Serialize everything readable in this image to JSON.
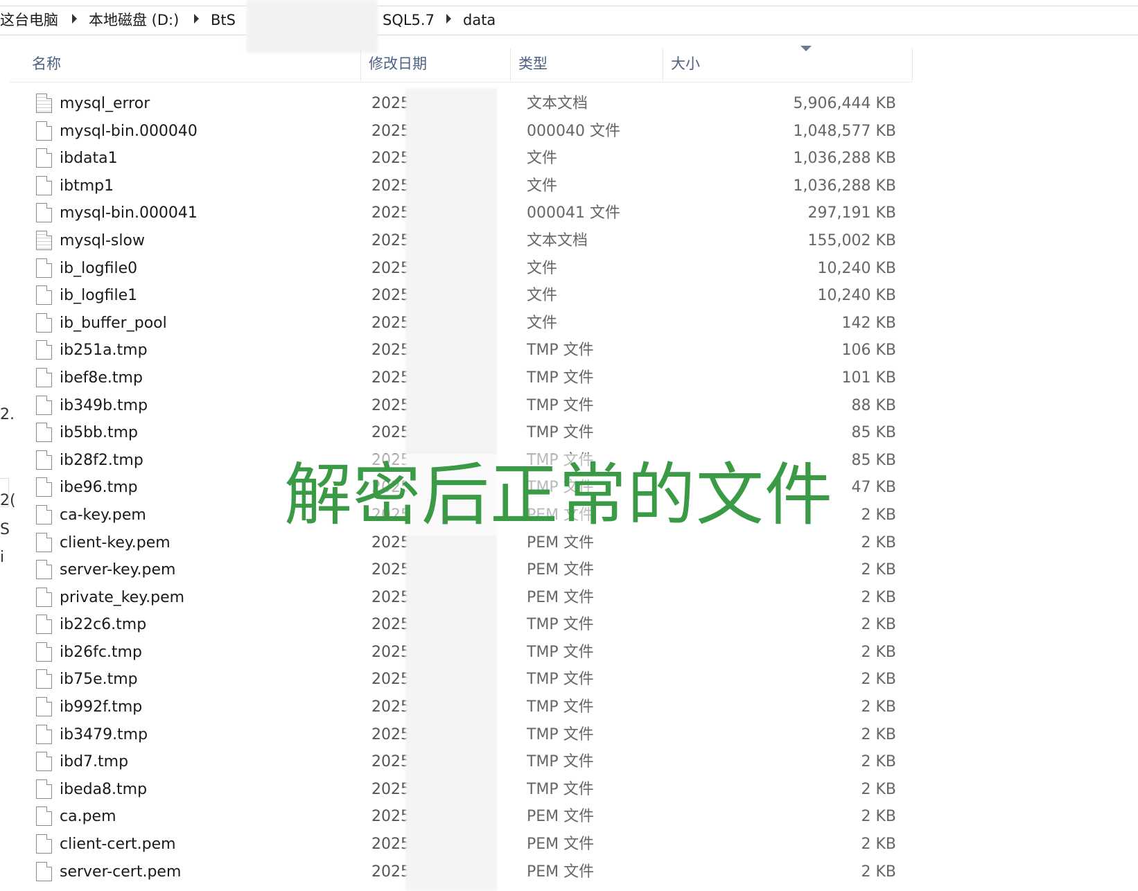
{
  "breadcrumb": {
    "items": [
      "这台电脑",
      "本地磁盘 (D:)",
      "BtS",
      "SQL5.7",
      "data"
    ]
  },
  "columns": {
    "name": "名称",
    "date": "修改日期",
    "type": "类型",
    "size": "大小"
  },
  "files": [
    {
      "name": "mysql_error",
      "date": "2025",
      "type": "文本文档",
      "size": "5,906,444 KB",
      "icon": "text-file-icon"
    },
    {
      "name": "mysql-bin.000040",
      "date": "2025",
      "type": "000040 文件",
      "size": "1,048,577 KB",
      "icon": "file-icon"
    },
    {
      "name": "ibdata1",
      "date": "2025",
      "type": "文件",
      "size": "1,036,288 KB",
      "icon": "file-icon"
    },
    {
      "name": "ibtmp1",
      "date": "2025",
      "type": "文件",
      "size": "1,036,288 KB",
      "icon": "file-icon"
    },
    {
      "name": "mysql-bin.000041",
      "date": "2025",
      "type": "000041 文件",
      "size": "297,191 KB",
      "icon": "file-icon"
    },
    {
      "name": "mysql-slow",
      "date": "2025",
      "type": "文本文档",
      "size": "155,002 KB",
      "icon": "text-file-icon"
    },
    {
      "name": "ib_logfile0",
      "date": "2025",
      "type": "文件",
      "size": "10,240 KB",
      "icon": "file-icon"
    },
    {
      "name": "ib_logfile1",
      "date": "2025",
      "type": "文件",
      "size": "10,240 KB",
      "icon": "file-icon"
    },
    {
      "name": "ib_buffer_pool",
      "date": "2025",
      "type": "文件",
      "size": "142 KB",
      "icon": "file-icon"
    },
    {
      "name": "ib251a.tmp",
      "date": "2025",
      "type": "TMP 文件",
      "size": "106 KB",
      "icon": "file-icon"
    },
    {
      "name": "ibef8e.tmp",
      "date": "2025",
      "type": "TMP 文件",
      "size": "101 KB",
      "icon": "file-icon"
    },
    {
      "name": "ib349b.tmp",
      "date": "2025",
      "type": "TMP 文件",
      "size": "88 KB",
      "icon": "file-icon"
    },
    {
      "name": "ib5bb.tmp",
      "date": "2025",
      "type": "TMP 文件",
      "size": "85 KB",
      "icon": "file-icon"
    },
    {
      "name": "ib28f2.tmp",
      "date": "2025",
      "type": "TMP 文件",
      "size": "85 KB",
      "icon": "file-icon"
    },
    {
      "name": "ibe96.tmp",
      "date": "2025",
      "type": "TMP 文件",
      "size": "47 KB",
      "icon": "file-icon"
    },
    {
      "name": "ca-key.pem",
      "date": "2025",
      "type": "PEM 文件",
      "size": "2 KB",
      "icon": "file-icon"
    },
    {
      "name": "client-key.pem",
      "date": "2025",
      "type": "PEM 文件",
      "size": "2 KB",
      "icon": "file-icon"
    },
    {
      "name": "server-key.pem",
      "date": "2025",
      "type": "PEM 文件",
      "size": "2 KB",
      "icon": "file-icon"
    },
    {
      "name": "private_key.pem",
      "date": "2025",
      "type": "PEM 文件",
      "size": "2 KB",
      "icon": "file-icon"
    },
    {
      "name": "ib22c6.tmp",
      "date": "2025",
      "type": "TMP 文件",
      "size": "2 KB",
      "icon": "file-icon"
    },
    {
      "name": "ib26fc.tmp",
      "date": "2025",
      "type": "TMP 文件",
      "size": "2 KB",
      "icon": "file-icon"
    },
    {
      "name": "ib75e.tmp",
      "date": "2025",
      "type": "TMP 文件",
      "size": "2 KB",
      "icon": "file-icon"
    },
    {
      "name": "ib992f.tmp",
      "date": "2025",
      "type": "TMP 文件",
      "size": "2 KB",
      "icon": "file-icon"
    },
    {
      "name": "ib3479.tmp",
      "date": "2025",
      "type": "TMP 文件",
      "size": "2 KB",
      "icon": "file-icon"
    },
    {
      "name": "ibd7.tmp",
      "date": "2025",
      "type": "TMP 文件",
      "size": "2 KB",
      "icon": "file-icon"
    },
    {
      "name": "ibeda8.tmp",
      "date": "2025",
      "type": "TMP 文件",
      "size": "2 KB",
      "icon": "file-icon"
    },
    {
      "name": "ca.pem",
      "date": "2025",
      "type": "PEM 文件",
      "size": "2 KB",
      "icon": "file-icon"
    },
    {
      "name": "client-cert.pem",
      "date": "2025",
      "type": "PEM 文件",
      "size": "2 KB",
      "icon": "file-icon"
    },
    {
      "name": "server-cert.pem",
      "date": "2025",
      "type": "PEM 文件",
      "size": "2 KB",
      "icon": "file-icon"
    }
  ],
  "overlay_caption": "解密后正常的文件",
  "left_pane_fragments": [
    "2.",
    "2(",
    "S",
    "i"
  ],
  "colors": {
    "header_text": "#4d6082",
    "caption_green": "#3b9a46"
  }
}
